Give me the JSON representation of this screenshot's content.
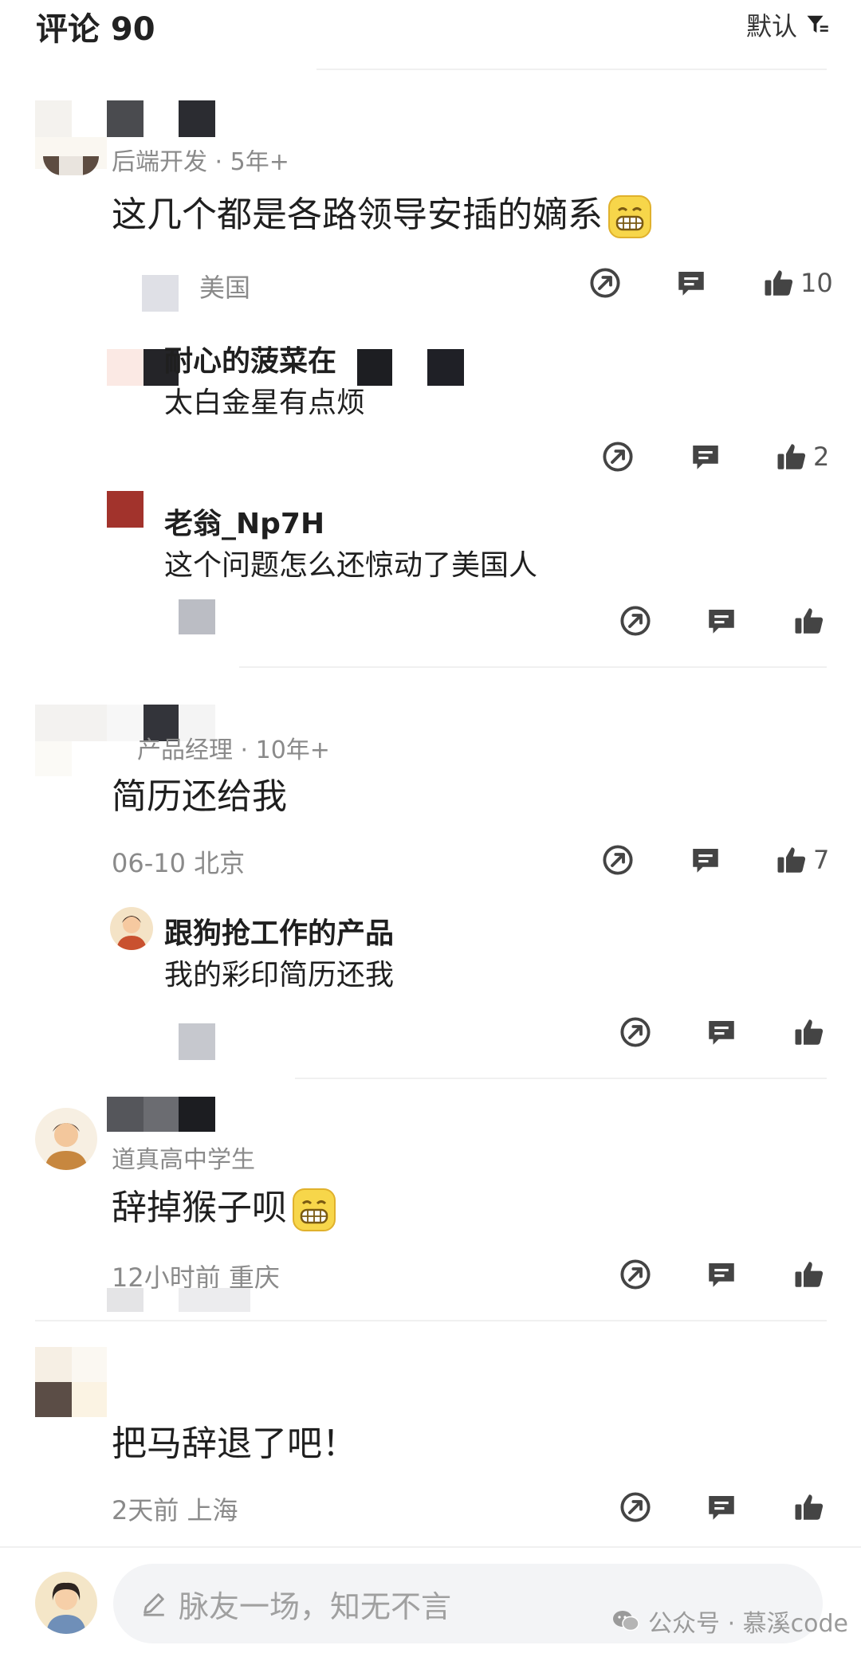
{
  "header": {
    "title": "评论 90",
    "sort_label": "默认"
  },
  "comments": [
    {
      "user_meta": "后端开发 · 5年+",
      "text": "这几个都是各路领导安插的嫡系",
      "meta": "美国",
      "likes": "10",
      "replies": [
        {
          "name": "耐心的菠菜在",
          "text": "太白金星有点烦",
          "likes": "2"
        },
        {
          "name": "老翁_Np7H",
          "text": "这个问题怎么还惊动了美国人",
          "likes": ""
        }
      ]
    },
    {
      "user_meta": "产品经理 · 10年+",
      "text": "简历还给我",
      "meta": "06-10  北京",
      "likes": "7",
      "replies": [
        {
          "name": "跟狗抢工作的产品",
          "text": "我的彩印简历还我",
          "likes": ""
        }
      ]
    },
    {
      "user_meta": "道真高中学生",
      "text": "辞掉猴子呗",
      "meta": "12小时前  重庆",
      "likes": ""
    },
    {
      "user_meta": "",
      "text": "把马辞退了吧！",
      "meta": "2天前  上海",
      "likes": ""
    }
  ],
  "input": {
    "placeholder": "脉友一场，知无不言"
  },
  "watermark": "公众号 · 慕溪code",
  "icons": [
    "filter-icon",
    "share-icon",
    "comment-icon",
    "thumbs-up-icon",
    "pencil-icon",
    "wechat-icon"
  ],
  "colors": {
    "text": "#1f1f1f",
    "meta": "#8a8a8a",
    "icon": "#4a4a4a",
    "input_bg": "#f3f4f6"
  }
}
